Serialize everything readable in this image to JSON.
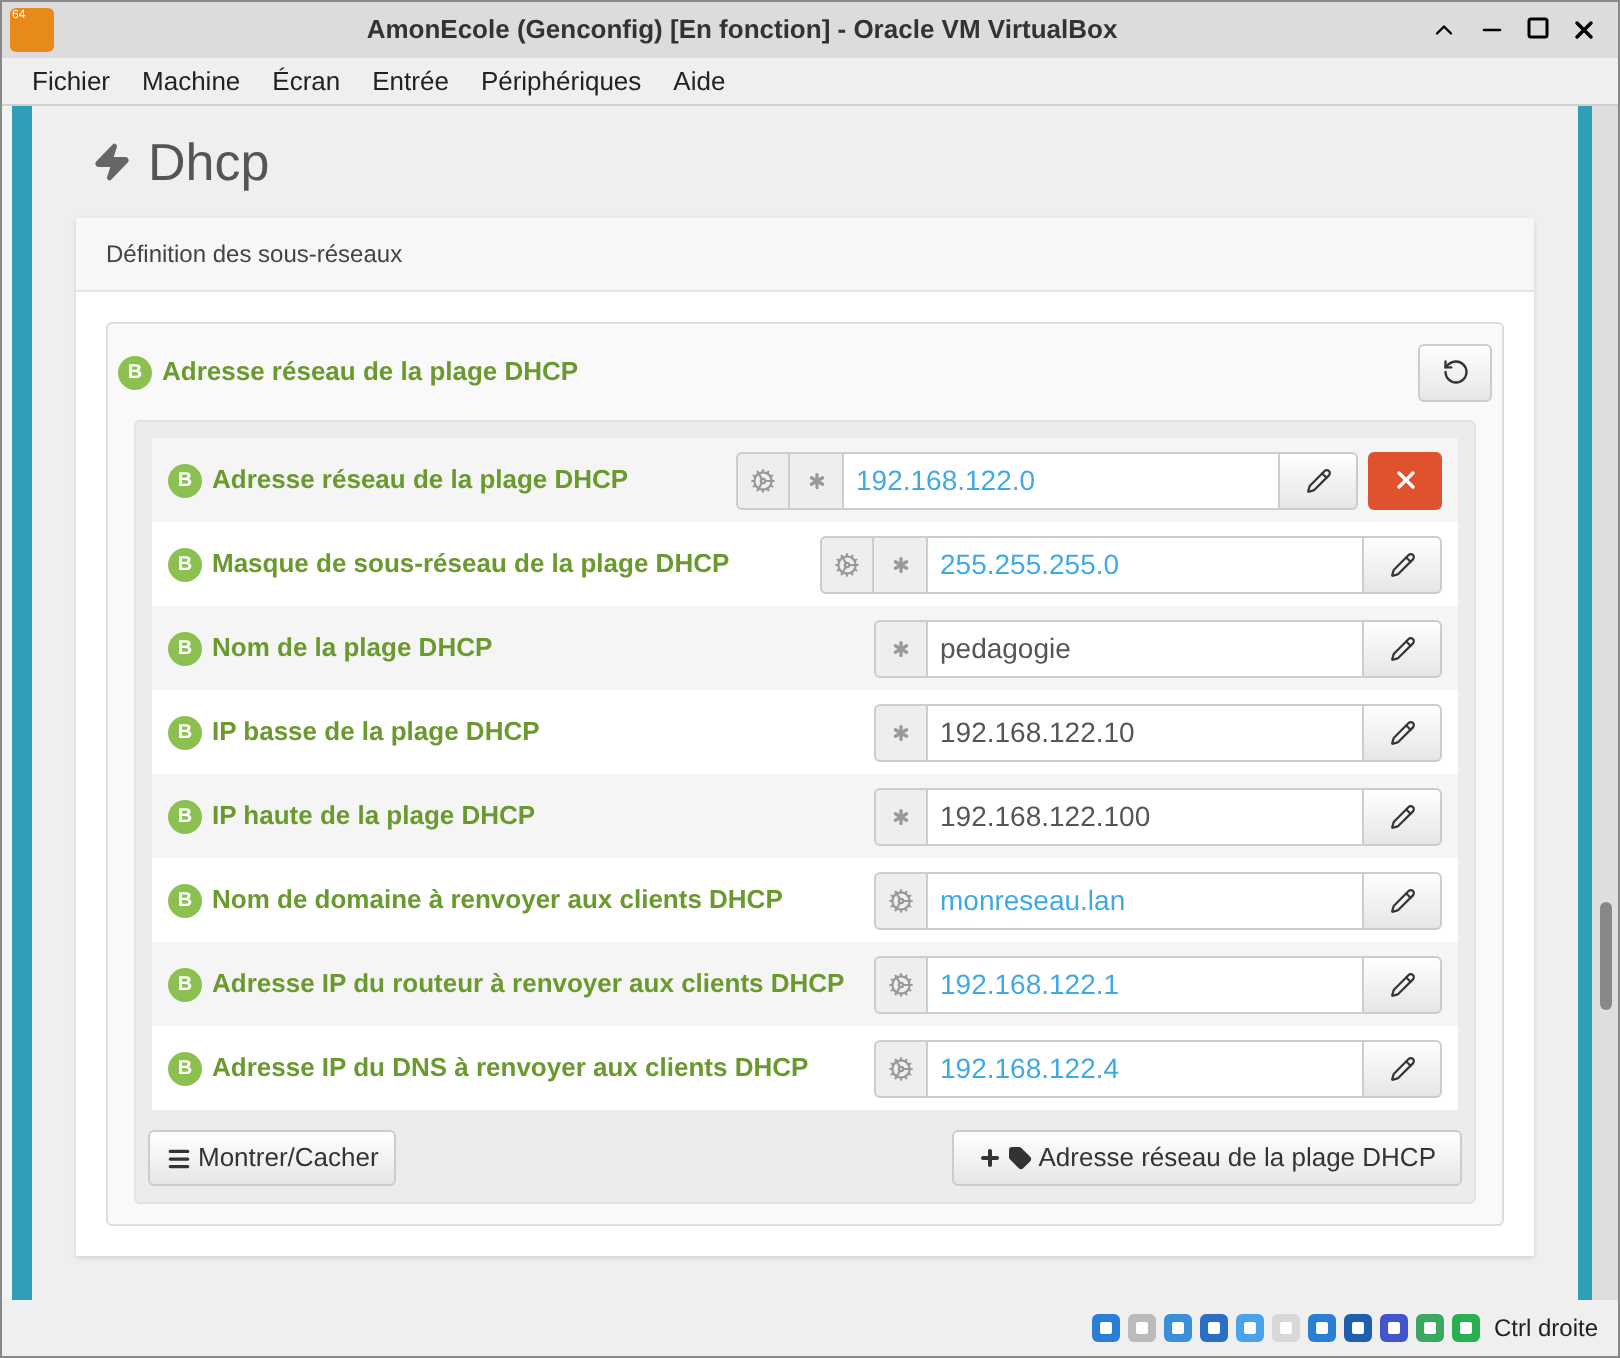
{
  "window": {
    "title": "AmonEcole (Genconfig) [En fonction] - Oracle VM VirtualBox",
    "app_badge": "64"
  },
  "menu": [
    "Fichier",
    "Machine",
    "Écran",
    "Entrée",
    "Périphériques",
    "Aide"
  ],
  "page_title": "Dhcp",
  "panel_title": "Définition des sous-réseaux",
  "group": {
    "badge": "B",
    "label": "Adresse réseau de la plage DHCP"
  },
  "rows": [
    {
      "badge": "B",
      "label": "Adresse réseau de la plage DHCP",
      "value": "192.168.122.0",
      "auto": true,
      "required": true,
      "deletable": true
    },
    {
      "badge": "B",
      "label": "Masque de sous-réseau de la plage DHCP",
      "value": "255.255.255.0",
      "auto": true,
      "required": true,
      "deletable": false
    },
    {
      "badge": "B",
      "label": "Nom de la plage DHCP",
      "value": "pedagogie",
      "auto": false,
      "required": true,
      "deletable": false
    },
    {
      "badge": "B",
      "label": "IP basse de la plage DHCP",
      "value": "192.168.122.10",
      "auto": false,
      "required": true,
      "deletable": false
    },
    {
      "badge": "B",
      "label": "IP haute de la plage DHCP",
      "value": "192.168.122.100",
      "auto": false,
      "required": true,
      "deletable": false
    },
    {
      "badge": "B",
      "label": "Nom de domaine à renvoyer aux clients DHCP",
      "value": "monreseau.lan",
      "auto": true,
      "required": false,
      "deletable": false
    },
    {
      "badge": "B",
      "label": "Adresse IP du routeur à renvoyer aux clients DHCP",
      "value": "192.168.122.1",
      "auto": true,
      "required": false,
      "deletable": false
    },
    {
      "badge": "B",
      "label": "Adresse IP du DNS à renvoyer aux clients DHCP",
      "value": "192.168.122.4",
      "auto": true,
      "required": false,
      "deletable": false
    }
  ],
  "buttons": {
    "toggle": "Montrer/Cacher",
    "add": "Adresse réseau de la plage DHCP"
  },
  "status_bar": {
    "host_key": "Ctrl droite"
  }
}
